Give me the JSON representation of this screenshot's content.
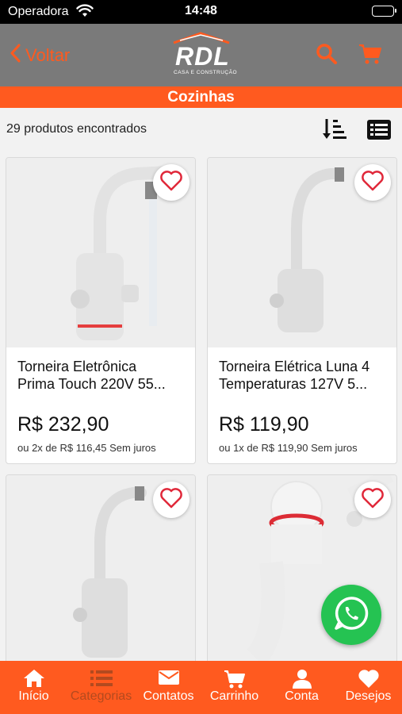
{
  "status_bar": {
    "carrier": "Operadora",
    "time": "14:48"
  },
  "navbar": {
    "back_label": "Voltar",
    "logo_text": "RDL",
    "logo_subtext": "CASA E CONSTRUÇÃO"
  },
  "category": {
    "title": "Cozinhas"
  },
  "results": {
    "count_text": "29 produtos encontrados"
  },
  "products": [
    {
      "name_line1": "Torneira Eletrônica",
      "name_line2": "Prima Touch 220V 55...",
      "price": "R$ 232,90",
      "installments": "ou 2x de R$ 116,45 Sem juros"
    },
    {
      "name_line1": "Torneira Elétrica Luna 4",
      "name_line2": "Temperaturas 127V 5...",
      "price": "R$ 119,90",
      "installments": "ou 1x de R$ 119,90 Sem juros"
    },
    {
      "name_line1": "",
      "name_line2": "",
      "price": "",
      "installments": ""
    },
    {
      "name_line1": "",
      "name_line2": "",
      "price": "",
      "installments": ""
    }
  ],
  "tabs": [
    {
      "label": "Início",
      "icon": "home-icon"
    },
    {
      "label": "Categorias",
      "icon": "list-icon"
    },
    {
      "label": "Contatos",
      "icon": "mail-icon"
    },
    {
      "label": "Carrinho",
      "icon": "cart-icon"
    },
    {
      "label": "Conta",
      "icon": "user-icon"
    },
    {
      "label": "Desejos",
      "icon": "heart-icon"
    }
  ],
  "colors": {
    "accent": "#ff5a1f",
    "navbar": "#7a7a7a",
    "whatsapp": "#25c352"
  }
}
